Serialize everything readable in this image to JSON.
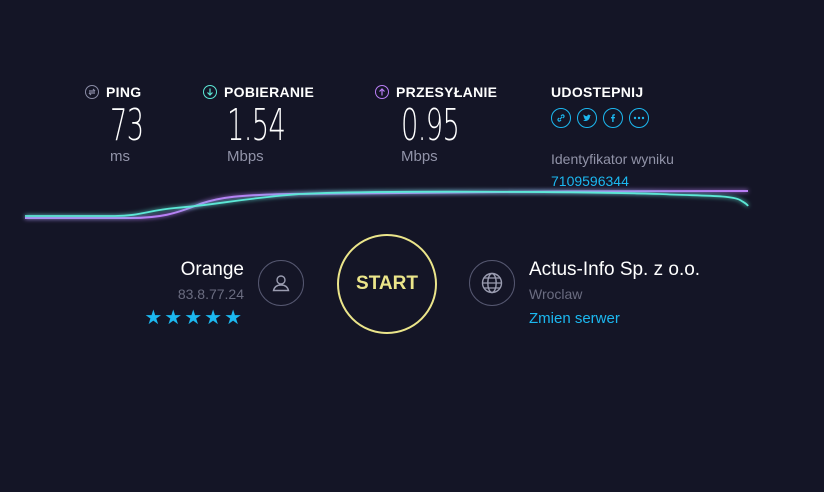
{
  "metrics": {
    "ping": {
      "label": "PING",
      "value": "73",
      "unit": "ms",
      "icon": "ping-icon",
      "color": "#8a8ca6"
    },
    "download": {
      "label": "POBIERANIE",
      "value": "1.54",
      "unit": "Mbps",
      "icon": "download-arrow-icon",
      "color": "#5ce8d6"
    },
    "upload": {
      "label": "PRZESYŁANIE",
      "value": "0.95",
      "unit": "Mbps",
      "icon": "upload-arrow-icon",
      "color": "#b97ef5"
    }
  },
  "share": {
    "label": "UDOSTEPNIJ",
    "icons": [
      "link-icon",
      "twitter-icon",
      "facebook-icon",
      "more-icon"
    ],
    "result_label": "Identyfikator wyniku",
    "result_id": "7109596344"
  },
  "isp": {
    "name": "Orange",
    "ip": "83.8.77.24",
    "rating": 5,
    "stars": "★★★★★",
    "icon": "user-icon"
  },
  "start": {
    "label": "START"
  },
  "server": {
    "name": "Actus-Info Sp. z o.o.",
    "location": "Wroclaw",
    "change_label": "Zmien serwer",
    "icon": "globe-icon"
  },
  "colors": {
    "background": "#141526",
    "accent": "#1cb8f0",
    "start": "#ebe58a",
    "download_line": "#5ce8d6",
    "upload_line": "#b97ef5"
  }
}
